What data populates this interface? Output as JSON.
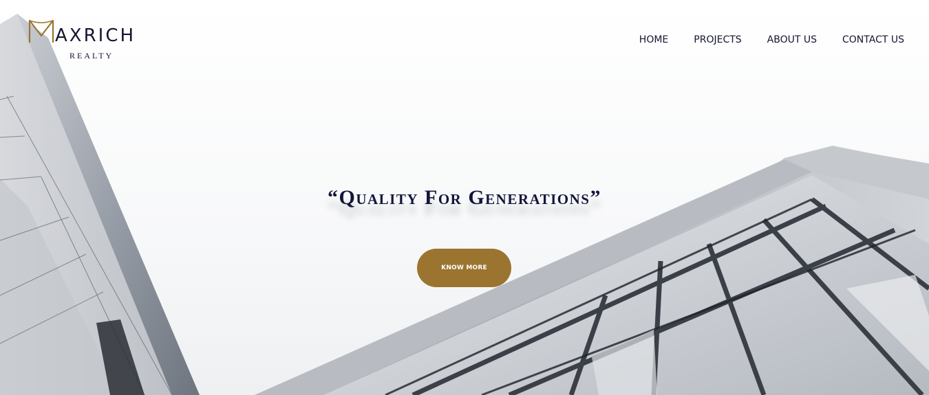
{
  "brand": {
    "name": "AXRICH",
    "tagline": "REALTY",
    "logo_icon": "m-arch-logo-icon",
    "accent_color": "#9b7430",
    "text_color": "#14152f"
  },
  "nav": {
    "items": [
      {
        "label": "HOME"
      },
      {
        "label": "PROJECTS"
      },
      {
        "label": "ABOUT US"
      },
      {
        "label": "CONTACT US"
      }
    ]
  },
  "hero": {
    "headline": "“Quality For Generations”",
    "cta_label": "KNOW MORE",
    "background": "building-facade-photo"
  }
}
